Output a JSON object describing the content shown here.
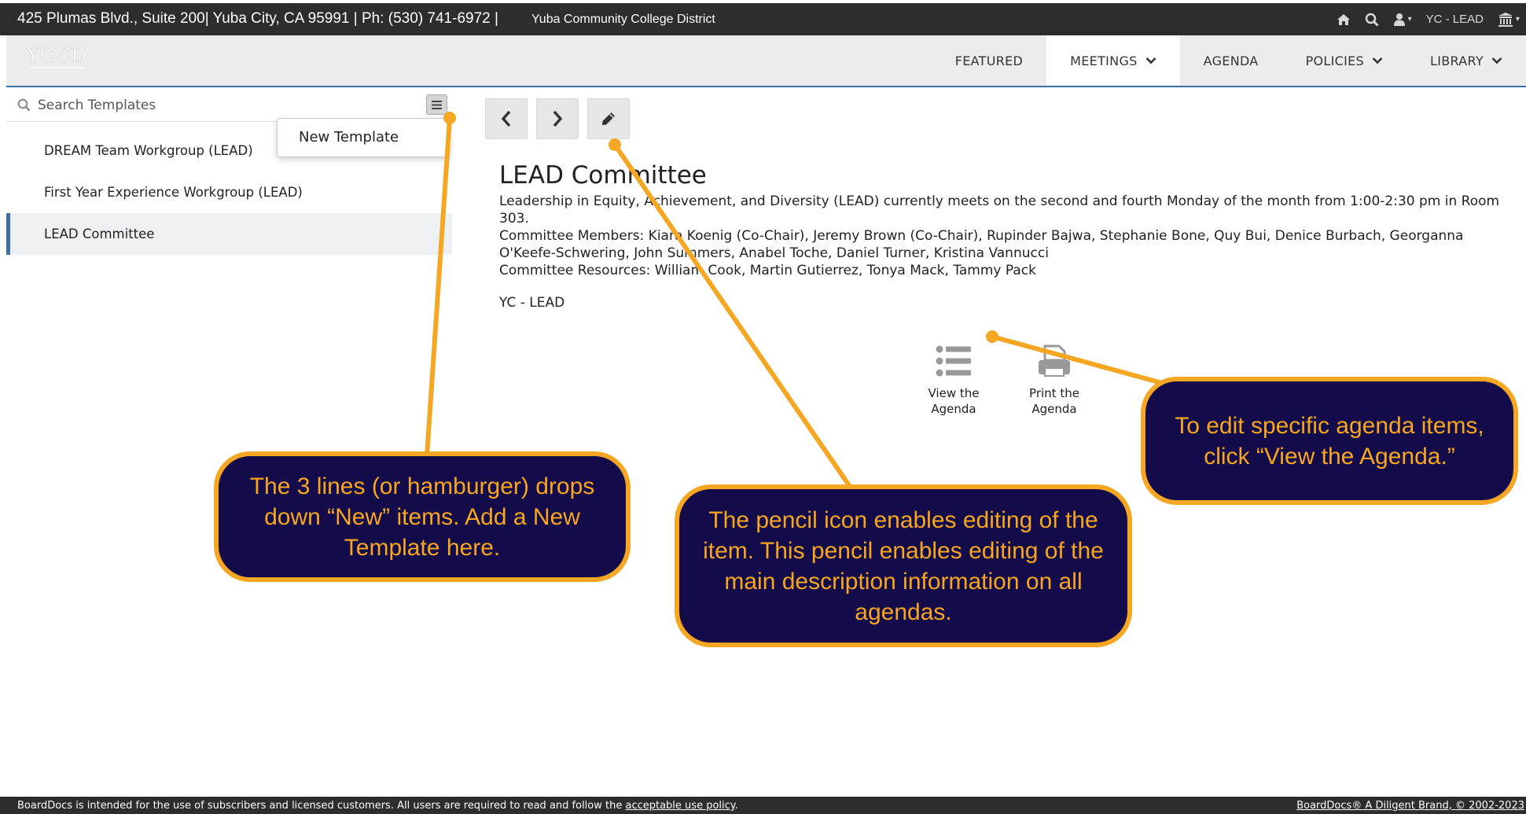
{
  "topbar": {
    "address": "425 Plumas Blvd., Suite 200| Yuba City, CA 95991 | Ph: (530) 741-6972 |",
    "district": "Yuba Community College District",
    "org_label": "YC - LEAD",
    "icons": [
      "home-icon",
      "search-icon",
      "user-icon",
      "building-icon"
    ]
  },
  "logo_text": "YCCD",
  "nav": {
    "items": [
      {
        "label": "FEATURED",
        "dropdown": false
      },
      {
        "label": "MEETINGS",
        "dropdown": true,
        "active": true
      },
      {
        "label": "AGENDA",
        "dropdown": false
      },
      {
        "label": "POLICIES",
        "dropdown": true
      },
      {
        "label": "LIBRARY",
        "dropdown": true
      }
    ]
  },
  "sidebar": {
    "search_placeholder": "Search Templates",
    "templates": [
      {
        "label": "DREAM Team Workgroup (LEAD)"
      },
      {
        "label": "First Year Experience Workgroup (LEAD)"
      },
      {
        "label": "LEAD Committee",
        "selected": true
      }
    ],
    "dropdown_item": "New Template"
  },
  "main": {
    "title": "LEAD Committee",
    "description_lines": [
      "Leadership in Equity, Achievement, and Diversity (LEAD) currently meets on the second and fourth Monday of the month from 1:00-2:30 pm in Room 303.",
      "Committee Members: Kiara Koenig (Co-Chair), Jeremy Brown (Co-Chair), Rupinder Bajwa, Stephanie Bone, Quy Bui, Denice Burbach, Georganna O'Keefe-Schwering, John Summers, Anabel Toche, Daniel Turner, Kristina Vannucci",
      "Committee Resources: William Cook, Martin Gutierrez, Tonya Mack, Tammy Pack"
    ],
    "org": "YC - LEAD",
    "actions": {
      "view": "View the Agenda",
      "print": "Print the Agenda"
    }
  },
  "callouts": {
    "hamburger": "The 3 lines (or hamburger) drops down “New” items. Add a New Template here.",
    "pencil": "The pencil icon enables editing of the item. This pencil enables editing of the main description information on all agendas.",
    "view_agenda": "To edit specific agenda items, click “View the Agenda.”"
  },
  "footer": {
    "left_prefix": "BoardDocs is intended for the use of subscribers and licensed customers. All users are required to read and follow the",
    "left_link": "acceptable use policy",
    "left_suffix": ".",
    "right": "BoardDocs® A Diligent Brand, © 2002-2023"
  },
  "colors": {
    "topbar_bg": "#2d2d2d",
    "nav_bg": "#ececec",
    "accent_blue": "#3e6ea3",
    "callout_bg": "#140b4a",
    "callout_border": "#f5a623",
    "callout_text": "#f6a61f"
  }
}
